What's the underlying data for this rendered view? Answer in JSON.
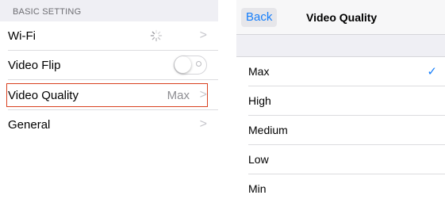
{
  "settings": {
    "section_title": "BASIC SETTING",
    "wifi_label": "Wi-Fi",
    "video_flip_label": "Video Flip",
    "video_flip_on": false,
    "video_quality_label": "Video Quality",
    "video_quality_value": "Max",
    "general_label": "General",
    "chevron": ">"
  },
  "quality_screen": {
    "back_label": "Back",
    "title": "Video Quality",
    "options": [
      "Max",
      "High",
      "Medium",
      "Low",
      "Min"
    ],
    "selected": "Max",
    "checkmark": "✓"
  },
  "colors": {
    "accent": "#157efb",
    "highlight_border": "#d8401f",
    "group_background": "#efeff4"
  },
  "icons": {
    "wifi_status": "loading-spinner-icon",
    "chevron": "chevron-right-icon",
    "selected": "checkmark-icon"
  }
}
